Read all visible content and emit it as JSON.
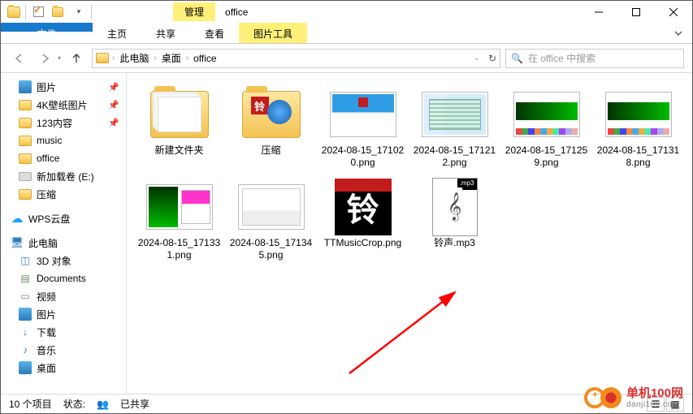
{
  "titlebar": {
    "context_tab": "管理",
    "window_title": "office"
  },
  "ribbon": {
    "file": "文件",
    "home": "主页",
    "share": "共享",
    "view": "查看",
    "picture_tools": "图片工具"
  },
  "breadcrumbs": [
    "此电脑",
    "桌面",
    "office"
  ],
  "search": {
    "placeholder": "在 office 中搜索"
  },
  "sidebar": {
    "items": [
      {
        "label": "图片",
        "icon": "pic",
        "pinned": true
      },
      {
        "label": "4K壁纸图片",
        "icon": "folder",
        "pinned": true
      },
      {
        "label": "123内容",
        "icon": "folder",
        "pinned": true
      },
      {
        "label": "music",
        "icon": "folder",
        "pinned": false
      },
      {
        "label": "office",
        "icon": "folder",
        "pinned": false
      },
      {
        "label": "新加载卷 (E:)",
        "icon": "drive",
        "pinned": false
      },
      {
        "label": "压缩",
        "icon": "folder",
        "pinned": false
      }
    ],
    "cloud": "WPS云盘",
    "thispc": "此电脑",
    "pcitems": [
      {
        "label": "3D 对象",
        "icon": "3d"
      },
      {
        "label": "Documents",
        "icon": "doc"
      },
      {
        "label": "视频",
        "icon": "vid"
      },
      {
        "label": "图片",
        "icon": "pic"
      },
      {
        "label": "下载",
        "icon": "dl"
      },
      {
        "label": "音乐",
        "icon": "music"
      },
      {
        "label": "桌面",
        "icon": "pic"
      }
    ]
  },
  "files": [
    {
      "name": "新建文件夹",
      "type": "folder-plain"
    },
    {
      "name": "压缩",
      "type": "folder-archive"
    },
    {
      "name": "2024-08-15_171020.png",
      "type": "img-a"
    },
    {
      "name": "2024-08-15_171212.png",
      "type": "img-b"
    },
    {
      "name": "2024-08-15_171259.png",
      "type": "img-d"
    },
    {
      "name": "2024-08-15_171318.png",
      "type": "img-d"
    },
    {
      "name": "2024-08-15_171331.png",
      "type": "img-e"
    },
    {
      "name": "2024-08-15_171345.png",
      "type": "img-f"
    },
    {
      "name": "TTMusicCrop.png",
      "type": "app-ling"
    },
    {
      "name": "铃声.mp3",
      "type": "mp3",
      "badge": ".mp3"
    }
  ],
  "glyph": {
    "ling": "铃"
  },
  "statusbar": {
    "count": "10 个项目",
    "status_label": "状态:",
    "shared": "已共享"
  },
  "watermark": {
    "line1": "单机100网",
    "line2": "danji100.com"
  }
}
